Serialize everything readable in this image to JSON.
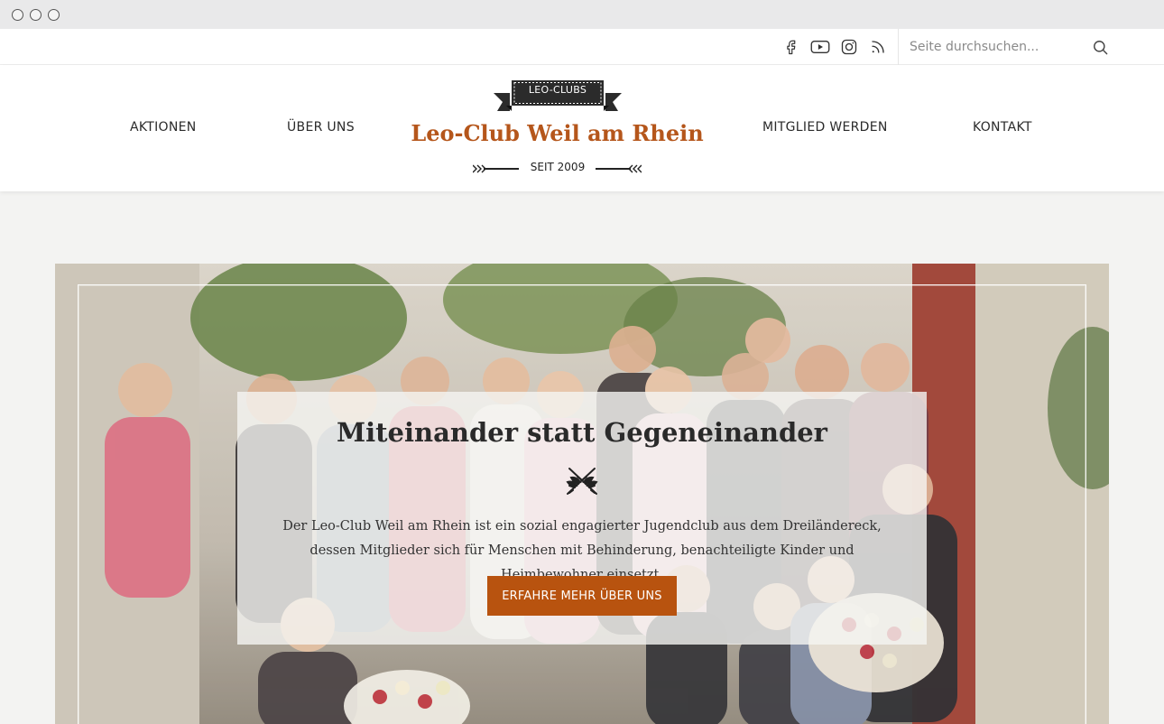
{
  "browser": {
    "window_controls": [
      "close",
      "minimize",
      "maximize"
    ]
  },
  "topbar": {
    "social_icons": [
      "facebook-icon",
      "youtube-icon",
      "instagram-icon",
      "rss-icon"
    ],
    "search": {
      "placeholder": "Seite durchsuchen...",
      "value": "",
      "icon": "search-icon"
    }
  },
  "nav": {
    "left": [
      {
        "label": "AKTIONEN"
      },
      {
        "label": "ÜBER UNS"
      }
    ],
    "right": [
      {
        "label": "MITGLIED WERDEN"
      },
      {
        "label": "KONTAKT"
      }
    ]
  },
  "logo": {
    "ribbon": "LEO-CLUBS",
    "title": "Leo-Club Weil am Rhein",
    "since": "SEIT 2009"
  },
  "hero": {
    "title": "Miteinander statt Gegeneinander",
    "text": "Der Leo-Club Weil am Rhein ist ein sozial engagierter Jugendclub aus dem Dreiländereck, dessen Mitglieder sich für Menschen mit Behinderung, benachteiligte Kinder und Heimbewohner einsetzt.",
    "cta": "ERFAHRE MEHR ÜBER UNS"
  },
  "colors": {
    "accent": "#b8530f",
    "logo_title": "#b5561b",
    "ribbon": "#2b2b2b",
    "text_dark": "#2a2a2a",
    "page_bg": "#f3f3f2"
  }
}
